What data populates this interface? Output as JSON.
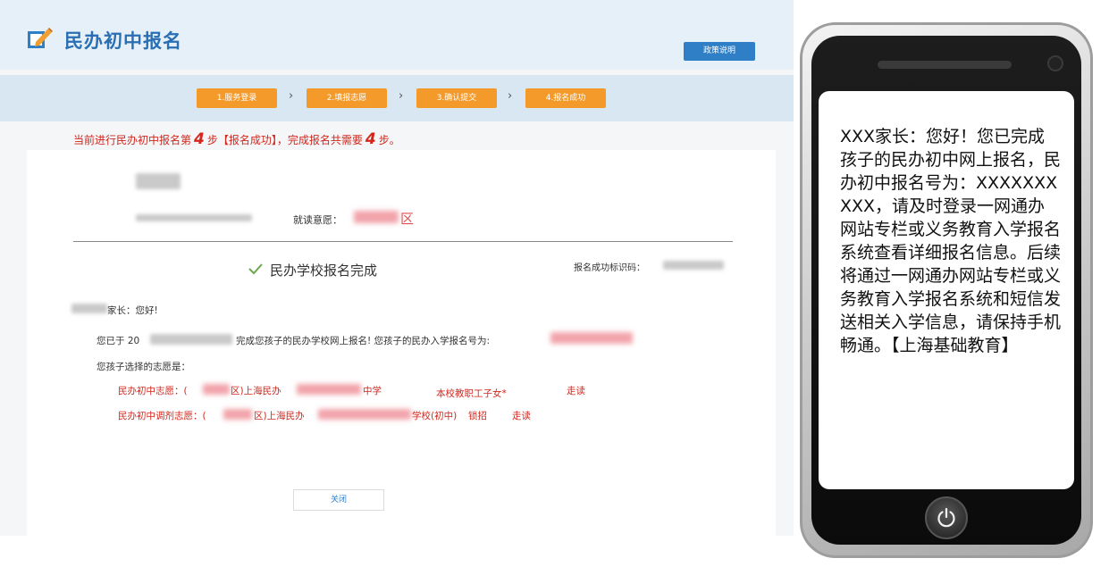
{
  "header": {
    "title": "民办初中报名",
    "help_label": "政策说明"
  },
  "steps": [
    {
      "label": "1.服务登录"
    },
    {
      "label": "2.填报志愿"
    },
    {
      "label": "3.确认提交"
    },
    {
      "label": "4.报名成功"
    }
  ],
  "step_arrow": "›",
  "progress": {
    "prefix": "当前进行民办初中报名第",
    "current": "4",
    "middle": "步【报名成功】，完成报名共需要",
    "total": "4",
    "suffix": "步。"
  },
  "card": {
    "intent_label": "就读意愿：",
    "intent_suffix": "区",
    "done_title": "民办学校报名完成",
    "id_label": "报名成功标识码：",
    "greeting": "家长：您好!",
    "line1_prefix": "您已于 20",
    "line1_suffix": "完成您孩子的民办学校网上报名! 您孩子的民办入学报名号为:",
    "line2": "您孩子选择的志愿是：",
    "choice1": {
      "label": "民办初中志愿：(",
      "mid": "区)上海民办",
      "school_end": "中学",
      "note": "本校教职工子女*",
      "mode": "走读"
    },
    "choice2": {
      "label": "民办初中调剂志愿：(",
      "mid": "区)上海民办",
      "school_end": "学校(初中)",
      "tag": "锁招",
      "mode": "走读"
    },
    "close_label": "关闭"
  },
  "phone": {
    "sms_text": "XXX家长：您好！您已完成孩子的民办初中网上报名，民办初中报名号为：XXXXXXXXXX，请及时登录一网通办网站专栏或义务教育入学报名系统查看详细报名信息。后续将通过一网通办网站专栏或义务教育入学报名系统和短信发送相关入学信息，请保持手机畅通。【上海基础教育】"
  },
  "colors": {
    "accent_blue": "#2f7fc6",
    "step_orange": "#f39a2b",
    "alert_red": "#d4261c"
  }
}
